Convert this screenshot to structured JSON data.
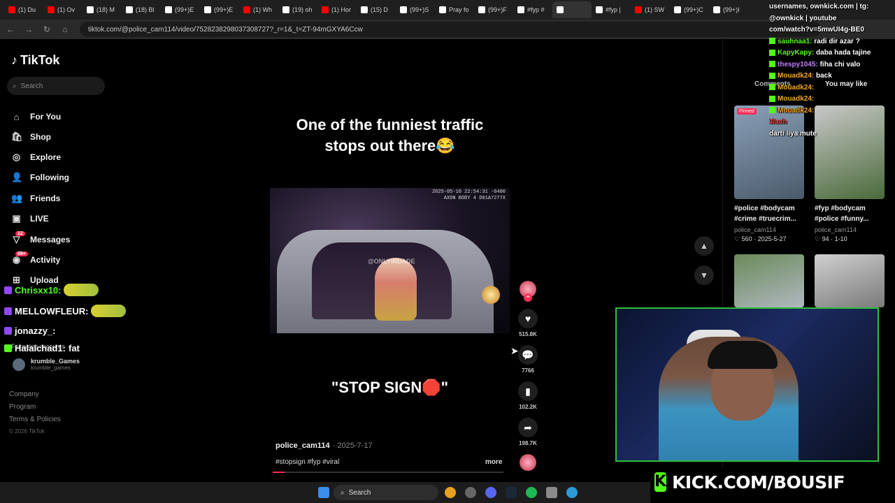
{
  "browser": {
    "tabs": [
      {
        "label": "(1) Du",
        "color": "#ff0000"
      },
      {
        "label": "(1) Ov",
        "color": "#ff0000"
      },
      {
        "label": "(18) M",
        "color": "#ffffff"
      },
      {
        "label": "(18) Bl",
        "color": "#ffffff"
      },
      {
        "label": "(99+)E",
        "color": "#ffffff"
      },
      {
        "label": "(99+)E",
        "color": "#ffffff"
      },
      {
        "label": "(1) Wh",
        "color": "#ff0000"
      },
      {
        "label": "(19) oh",
        "color": "#ffffff"
      },
      {
        "label": "(1) Hor",
        "color": "#ff0000"
      },
      {
        "label": "(15) D",
        "color": "#ffffff"
      },
      {
        "label": "(99+)S",
        "color": "#ffffff"
      },
      {
        "label": "Pray fo",
        "color": "#ffffff"
      },
      {
        "label": "(99+)F",
        "color": "#ffffff"
      },
      {
        "label": "#fyp #",
        "color": "#ffffff"
      },
      {
        "label": "",
        "color": "#ffffff",
        "active": true
      },
      {
        "label": "#fyp |",
        "color": "#ffffff"
      },
      {
        "label": "(1) SW",
        "color": "#ff0000"
      },
      {
        "label": "(99+)C",
        "color": "#ffffff"
      },
      {
        "label": "(99+)I",
        "color": "#ffffff"
      }
    ],
    "url": "tiktok.com/@police_cam114/video/7528238298037308727?_r=1&_t=ZT-94mGXYA6Ccw"
  },
  "sidebar": {
    "logo": "TikTok",
    "search_placeholder": "Search",
    "nav": [
      {
        "label": "For You",
        "icon": "home-icon",
        "glyph": "⌂"
      },
      {
        "label": "Shop",
        "icon": "shop-icon",
        "glyph": "🛍"
      },
      {
        "label": "Explore",
        "icon": "compass-icon",
        "glyph": "◎"
      },
      {
        "label": "Following",
        "icon": "following-icon",
        "glyph": "👤"
      },
      {
        "label": "Friends",
        "icon": "friends-icon",
        "glyph": "👥"
      },
      {
        "label": "LIVE",
        "icon": "live-icon",
        "glyph": "▣"
      },
      {
        "label": "Messages",
        "icon": "messages-icon",
        "glyph": "▽",
        "badge": "12"
      },
      {
        "label": "Activity",
        "icon": "activity-icon",
        "glyph": "◉",
        "badge": "99+"
      },
      {
        "label": "Upload",
        "icon": "upload-icon",
        "glyph": "⊞"
      }
    ],
    "following_accounts_label": "Following accounts",
    "account": {
      "name": "krumble_Games",
      "handle": "krumble_games"
    },
    "footer": {
      "company": "Company",
      "program": "Program",
      "terms": "Terms & Policies",
      "copyright": "© 2026 TikTok"
    }
  },
  "overlay_chat": [
    {
      "user": "Chrisxx10:",
      "color": "#53fc18",
      "platform": "twitch"
    },
    {
      "user": "MELLOWFLEUR:",
      "color": "#ffffff",
      "platform": "twitch"
    },
    {
      "user": "jonazzy_:",
      "color": "#ffffff",
      "platform": "twitch"
    },
    {
      "user": "Halalchad1:",
      "message": "fat",
      "color": "#ffffff",
      "platform": "kick"
    }
  ],
  "video": {
    "caption_top": "One of the funniest traffic stops out there😂",
    "caption_bottom": "\"STOP SIGN🛑\"",
    "bodycam_stamp": "2025-05-10 22:54:31 -0400\nAXON BODY 4 D01A7277X",
    "watermark": "@ONLYINDADE",
    "author": "police_cam114",
    "date": "2025-7-17",
    "tags": "#stopsign #fyp #viral",
    "more": "more",
    "progress_fraction": 0.05,
    "actions": {
      "likes": "515.8K",
      "comments": "7766",
      "saves": "102.2K",
      "shares": "198.7K"
    }
  },
  "right_panel": {
    "tab_comments": "Comments",
    "tab_you_may_like": "You may like",
    "items": [
      {
        "caption": "#police #bodycam #crime #truecrim...",
        "user": "police_cam114",
        "likes": "560",
        "date": "2025-5-27",
        "pinned": "Pinned",
        "color1": "#8aa0b8",
        "color2": "#4a5a6a"
      },
      {
        "caption": "#fyp #bodycam #police #funny...",
        "user": "police_cam114",
        "likes": "94",
        "date": "1-10",
        "color1": "#c8c8c8",
        "color2": "#4a6a3a"
      },
      {
        "caption": "",
        "user": "",
        "likes": "",
        "date": "",
        "color1": "#6a8a5a",
        "color2": "#b0b8c0"
      },
      {
        "caption": "",
        "user": "",
        "likes": "",
        "date": "",
        "color1": "#d0d0d0",
        "color2": "#7a7a7a"
      }
    ]
  },
  "kick_chat": [
    {
      "user": "",
      "text": "usernames, ownkick.com | tg:",
      "color": "#ffffff"
    },
    {
      "user": "",
      "text": "@ownkick | youtube",
      "color": "#ffffff"
    },
    {
      "user": "",
      "text": "com/watch?v=5mwUI4g-BE0",
      "color": "#ffffff"
    },
    {
      "user": "sauhnaa1:",
      "text": "radi dir azar ?",
      "color": "#53fc18"
    },
    {
      "user": "KapyKapy:",
      "text": "daba hada tajine",
      "color": "#53fc18"
    },
    {
      "user": "thespy1045:",
      "text": "fiha chi valo",
      "color": "#c07cff"
    },
    {
      "user": "Mouadk24:",
      "text": "back",
      "color": "#f5a623"
    },
    {
      "user": "Mouadk24:",
      "text": "",
      "color": "#f5a623"
    },
    {
      "user": "Mouadk24:",
      "text": "",
      "color": "#f5a623"
    },
    {
      "user": "Mouadk24:",
      "text": "",
      "color": "#f5a623"
    },
    {
      "user": "",
      "text": "3lach",
      "color": "#ff4040"
    },
    {
      "user": "",
      "text": "darti liya mute",
      "color": "#ffffff"
    }
  ],
  "kick_banner": "KICK.COM/BOUSIF",
  "taskbar": {
    "search": "Search"
  }
}
